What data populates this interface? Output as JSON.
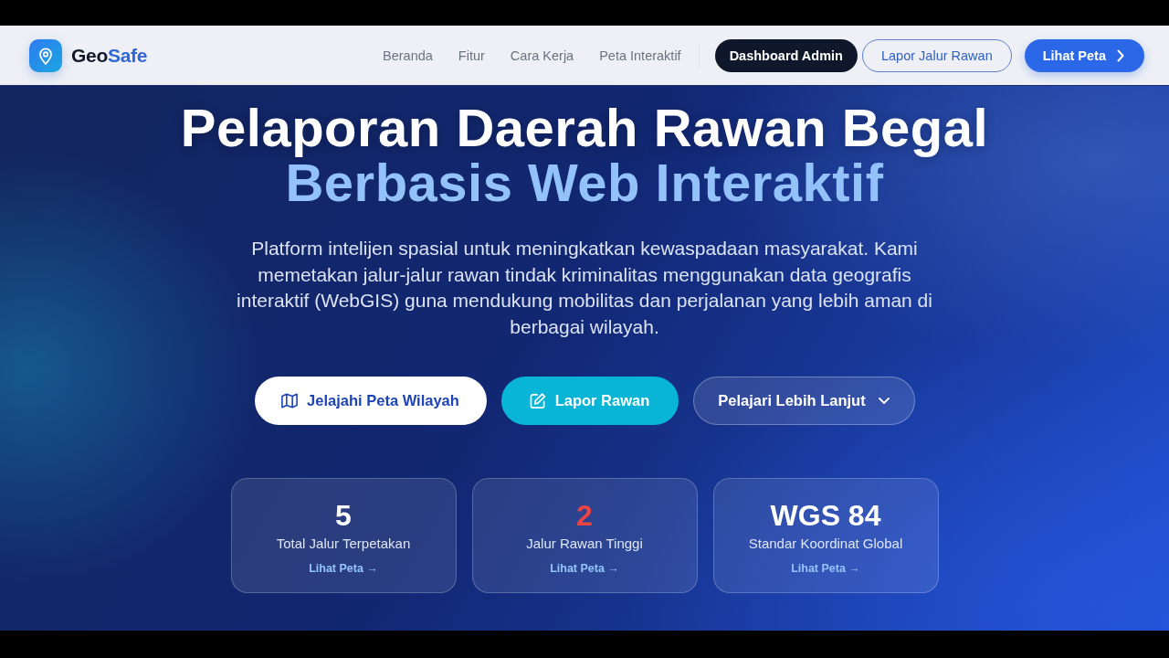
{
  "nav": {
    "brand": {
      "part_1": "Geo",
      "part_2": "Safe"
    },
    "links": [
      "Beranda",
      "Fitur",
      "Cara Kerja",
      "Peta Interaktif"
    ],
    "buttons": [
      {
        "label": "Dashboard Admin",
        "kind": "dark"
      },
      {
        "label": "Lapor Jalur Rawan",
        "kind": "outline"
      },
      {
        "label": "Lihat Peta",
        "kind": "primary"
      }
    ]
  },
  "hero": {
    "title_line_1": "Pelaporan Daerah Rawan Begal",
    "title_line_2": "Berbasis Web Interaktif",
    "description": "Platform intelijen spasial untuk meningkatkan kewaspadaan masyarakat. Kami memetakan jalur-jalur rawan tindak kriminalitas menggunakan data geografis interaktif (WebGIS) guna mendukung mobilitas dan perjalanan yang lebih aman di berbagai wilayah.",
    "buttons": [
      {
        "label": "Jelajahi Peta Wilayah",
        "kind": "light"
      },
      {
        "label": "Lapor Rawan",
        "kind": "accent"
      },
      {
        "label": "Pelajari Lebih Lanjut",
        "kind": "ghost"
      }
    ]
  },
  "stats": [
    {
      "value": "5",
      "color": "#ffffff",
      "label": "Total Jalur Terpetakan",
      "link": "Lihat Peta →"
    },
    {
      "value": "2",
      "color": "#ef4444",
      "label": "Jalur Rawan Tinggi",
      "link": "Lihat Peta →"
    },
    {
      "value": "WGS 84",
      "color": "#ffffff",
      "label": "Standar Koordinat Global",
      "link": "Lihat Peta →"
    }
  ]
}
